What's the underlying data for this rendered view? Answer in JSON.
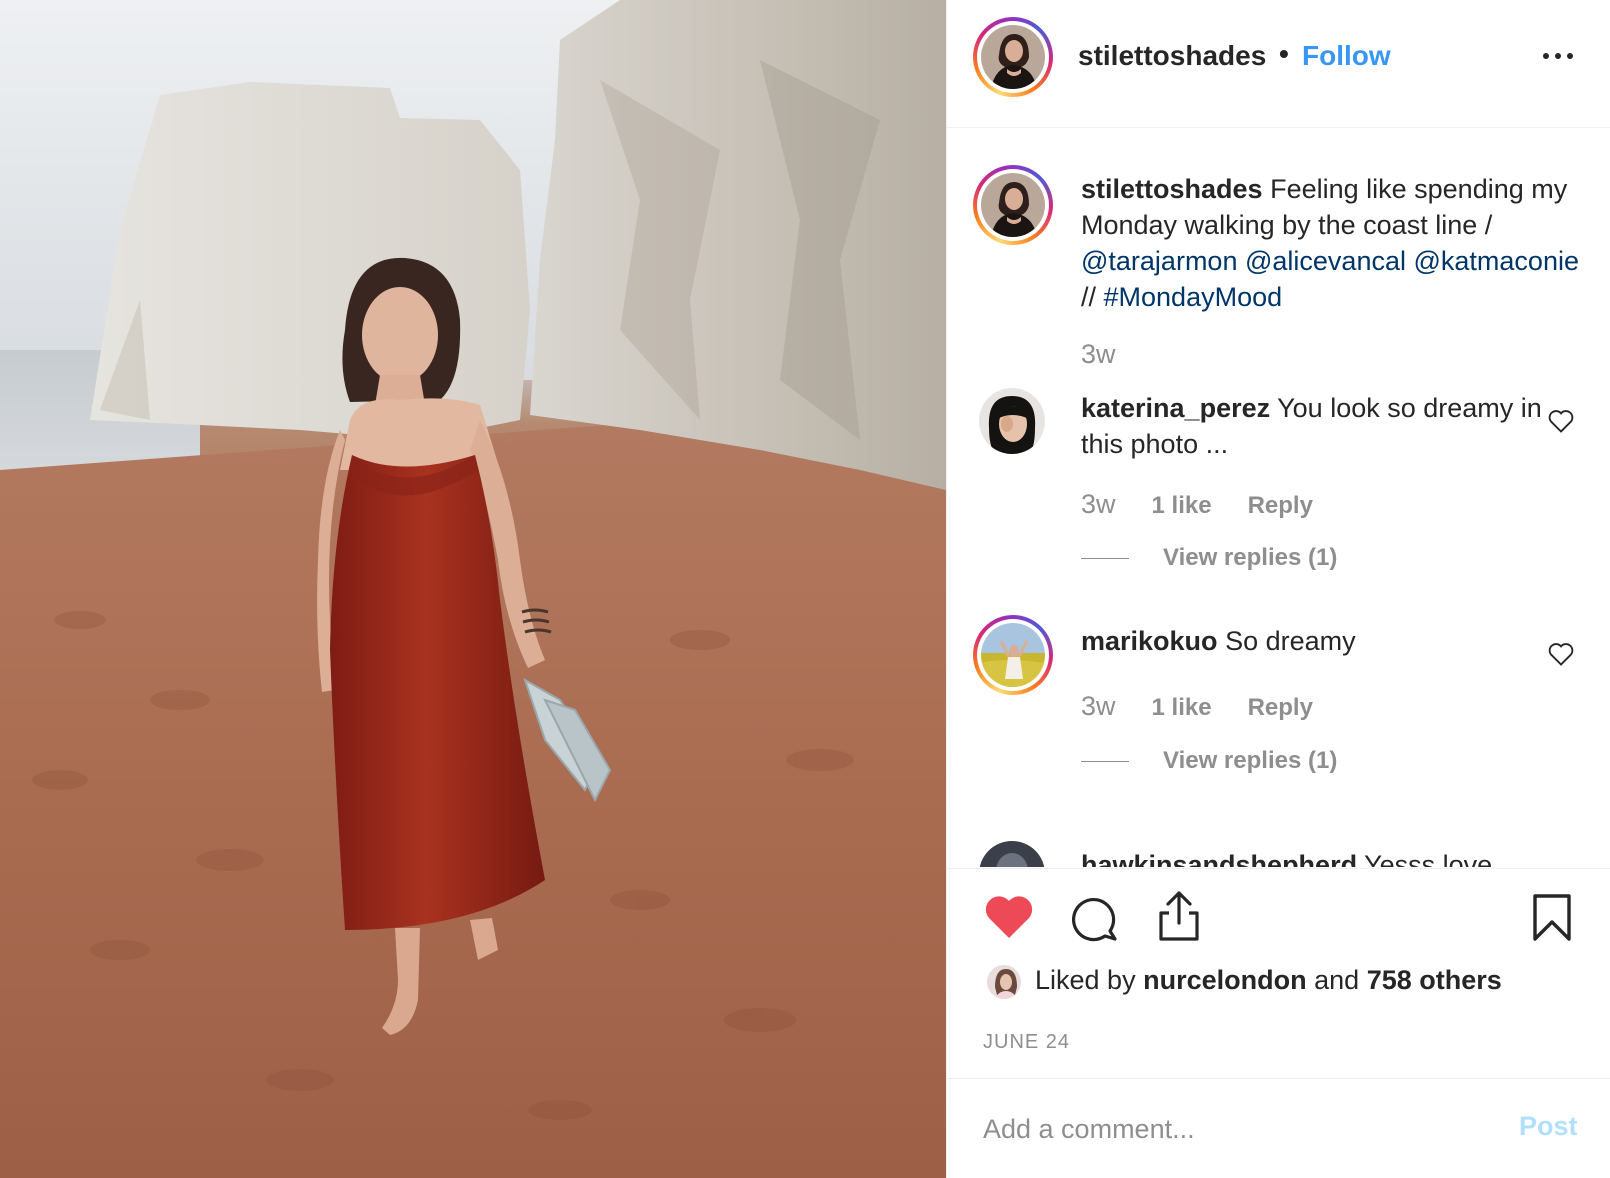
{
  "post": {
    "author": "stilettoshades",
    "bullet": "•",
    "follow_label": "Follow",
    "more_icon": "more-options-icon"
  },
  "caption": {
    "username": "stilettoshades",
    "text": "Feeling like spending my Monday walking by the coast line / ",
    "mention_1": "@tarajarmon",
    "mention_2": "@alicevancal",
    "mention_3": "@katmaconie",
    "separator": " // ",
    "hashtag": "#MondayMood",
    "time": "3w"
  },
  "comments": [
    {
      "username": "katerina_perez",
      "text": "You look so dreamy in this photo ...",
      "time": "3w",
      "likes": "1 like",
      "reply": "Reply",
      "view_replies": "View replies (1)"
    },
    {
      "username": "marikokuo",
      "text": "So dreamy",
      "time": "3w",
      "likes": "1 like",
      "reply": "Reply",
      "view_replies": "View replies (1)"
    },
    {
      "username": "hawkinsandshepherd",
      "text": "Yesss love"
    }
  ],
  "actions": {
    "liked_prefix": "Liked by",
    "liked_user": "nurcelondon",
    "liked_and": "and",
    "liked_others": "758 others",
    "date": "JUNE 24",
    "like_color": "#ed4956"
  },
  "add_comment": {
    "placeholder": "Add a comment...",
    "post_label": "Post"
  },
  "colors": {
    "link": "#3897f0",
    "mention": "#003569",
    "muted": "#8e8e8e"
  }
}
